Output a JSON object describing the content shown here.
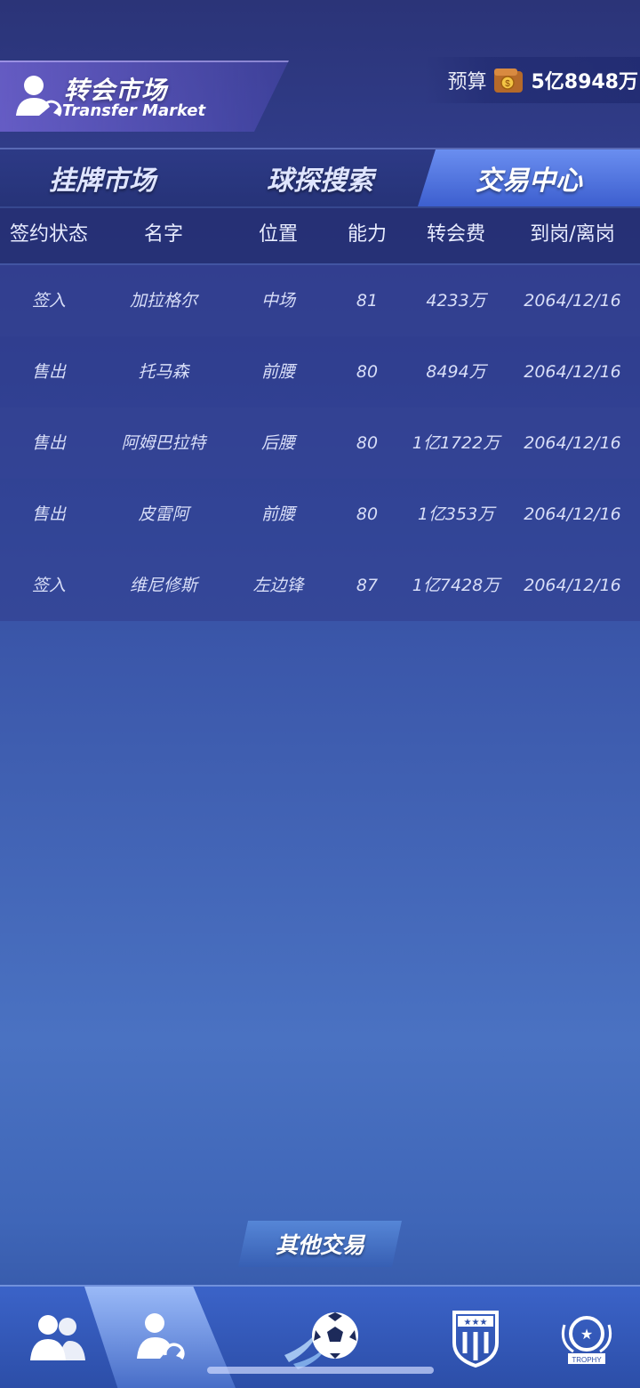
{
  "header": {
    "title_cn": "转会市场",
    "title_en": "Transfer Market",
    "budget_label": "预算",
    "budget_value": "5亿8948万"
  },
  "tabs": [
    {
      "label": "挂牌市场",
      "active": false
    },
    {
      "label": "球探搜索",
      "active": false
    },
    {
      "label": "交易中心",
      "active": true
    }
  ],
  "table": {
    "columns": [
      "签约状态",
      "名字",
      "位置",
      "能力",
      "转会费",
      "到岗/离岗"
    ],
    "rows": [
      [
        "签入",
        "加拉格尔",
        "中场",
        "81",
        "4233万",
        "2064/12/16"
      ],
      [
        "售出",
        "托马森",
        "前腰",
        "80",
        "8494万",
        "2064/12/16"
      ],
      [
        "售出",
        "阿姆巴拉特",
        "后腰",
        "80",
        "1亿1722万",
        "2064/12/16"
      ],
      [
        "售出",
        "皮雷阿",
        "前腰",
        "80",
        "1亿353万",
        "2064/12/16"
      ],
      [
        "签入",
        "维尼修斯",
        "左边锋",
        "87",
        "1亿7428万",
        "2064/12/16"
      ]
    ]
  },
  "other_trade_label": "其他交易",
  "nav": {
    "items": [
      "team-icon",
      "transfer-icon",
      "match-icon",
      "club-crest-icon",
      "trophy-icon"
    ],
    "trophy_text": "TROPHY"
  },
  "colors": {
    "accent": "#5f86ea",
    "bg_top": "#2b3478",
    "bg_mid": "#4a72c2"
  }
}
